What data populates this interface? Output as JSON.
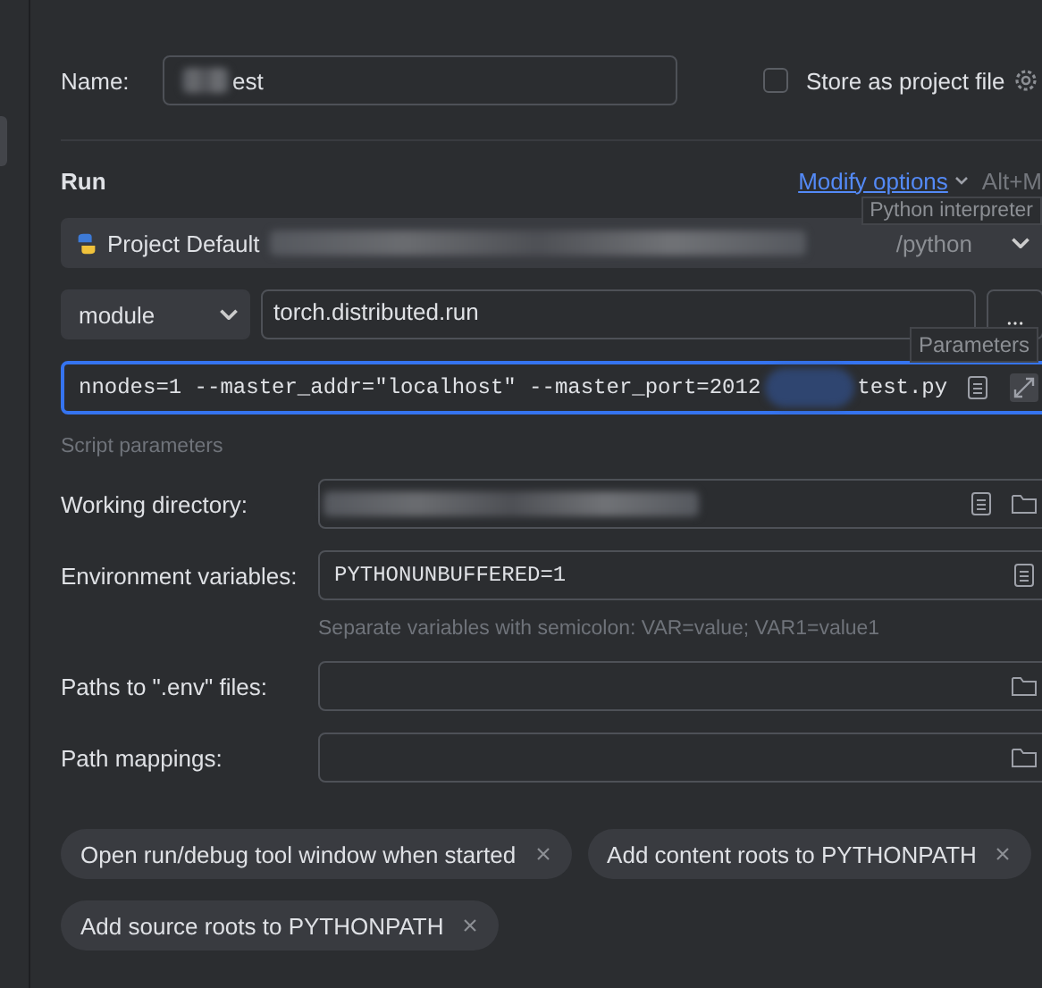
{
  "name_field": {
    "label": "Name:",
    "value": "est"
  },
  "store_as_project_file": {
    "label": "Store as project file",
    "checked": false
  },
  "run_section": {
    "title": "Run",
    "modify_options": "Modify options",
    "shortcut": "Alt+M"
  },
  "interpreter": {
    "value": "Project Default",
    "suffix": "/python",
    "tooltip": "Python interpreter"
  },
  "module_row": {
    "mode": "module",
    "target": "torch.distributed.run",
    "tooltip": "Parameters"
  },
  "script_parameters": {
    "value_start": "nnodes=1 --master_addr=\"localhost\" --master_port=2012",
    "value_end": "test.py",
    "focused": true,
    "caption": "Script parameters"
  },
  "fields": [
    {
      "label": "Working directory:",
      "kind": "dir"
    },
    {
      "label": "Environment variables:",
      "value": "PYTHONUNBUFFERED=1",
      "kind": "env",
      "hint": "Separate variables with semicolon: VAR=value; VAR1=value1"
    },
    {
      "label": "Paths to \".env\" files:",
      "kind": "path"
    },
    {
      "label": "Path mappings:",
      "kind": "path"
    }
  ],
  "options": [
    "Open run/debug tool window when started",
    "Add content roots to PYTHONPATH",
    "Add source roots to PYTHONPATH"
  ]
}
